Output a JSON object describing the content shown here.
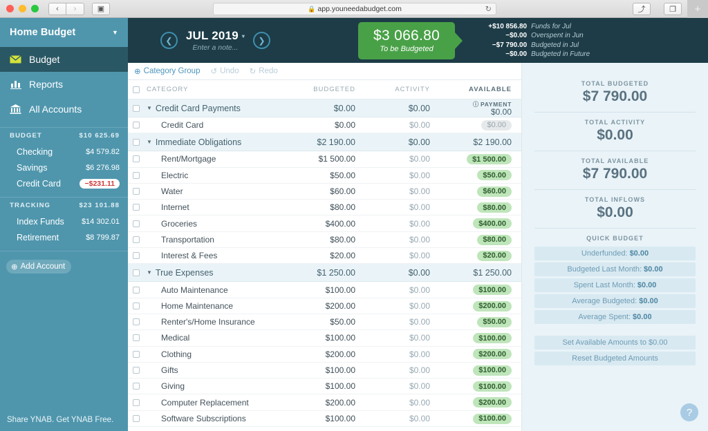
{
  "browser": {
    "back_label": "‹",
    "forward_label": "›",
    "sidebar_toggle_label": "▣",
    "url": "app.youneedabudget.com",
    "lock_icon": "🔒",
    "reload_label": "↻",
    "share_label": "⤴",
    "tabs_label": "❐",
    "new_tab_label": "+"
  },
  "sidebar": {
    "budget_name": "Home Budget",
    "caret": "▼",
    "nav": [
      {
        "label": "Budget",
        "icon": "envelope-icon",
        "active": true
      },
      {
        "label": "Reports",
        "icon": "bar-chart-icon",
        "active": false
      },
      {
        "label": "All Accounts",
        "icon": "bank-icon",
        "active": false
      }
    ],
    "sections": [
      {
        "title": "BUDGET",
        "total": "$10 625.69",
        "chevron": "ⱟ",
        "accounts": [
          {
            "name": "Checking",
            "balance": "$4 579.82",
            "negative": false
          },
          {
            "name": "Savings",
            "balance": "$6 276.98",
            "negative": false
          },
          {
            "name": "Credit Card",
            "balance": "−$231.11",
            "negative": true
          }
        ]
      },
      {
        "title": "TRACKING",
        "total": "$23 101.88",
        "chevron": "ⱟ",
        "accounts": [
          {
            "name": "Index Funds",
            "balance": "$14 302.01",
            "negative": false
          },
          {
            "name": "Retirement",
            "balance": "$8 799.87",
            "negative": false
          }
        ]
      }
    ],
    "add_account_label": "Add Account",
    "add_account_icon": "⊕",
    "share_label": "Share YNAB. Get YNAB Free."
  },
  "month_header": {
    "prev_icon": "❮",
    "next_icon": "❯",
    "month": "JUL 2019",
    "caret": "▾",
    "note_placeholder": "Enter a note...",
    "to_be_budgeted": {
      "amount": "$3 066.80",
      "label": "To be Budgeted",
      "color": "#49a147"
    },
    "breakdown": [
      {
        "value": "+$10 856.80",
        "label": "Funds for Jul"
      },
      {
        "value": "−$0.00",
        "label": "Overspent in Jun"
      },
      {
        "value": "−$7 790.00",
        "label": "Budgeted in Jul"
      },
      {
        "value": "−$0.00",
        "label": "Budgeted in Future"
      }
    ]
  },
  "toolbar": {
    "category_group_label": "Category Group",
    "category_group_icon": "⊕",
    "undo_label": "Undo",
    "undo_icon": "↺",
    "redo_label": "Redo",
    "redo_icon": "↻"
  },
  "table": {
    "columns": {
      "category": "CATEGORY",
      "budgeted": "BUDGETED",
      "activity": "ACTIVITY",
      "available": "AVAILABLE"
    },
    "twisty": "▼",
    "rows": [
      {
        "type": "group",
        "name": "Credit Card Payments",
        "budgeted": "$0.00",
        "activity": "$0.00",
        "available": "$0.00",
        "available_tag": "PAYMENT",
        "available_tag_icon": "ⓘ"
      },
      {
        "type": "category",
        "name": "Credit Card",
        "budgeted": "$0.00",
        "activity": "$0.00",
        "available": "$0.00",
        "available_style": "zero"
      },
      {
        "type": "group",
        "name": "Immediate Obligations",
        "budgeted": "$2 190.00",
        "activity": "$0.00",
        "available": "$2 190.00"
      },
      {
        "type": "category",
        "name": "Rent/Mortgage",
        "budgeted": "$1 500.00",
        "activity": "$0.00",
        "available": "$1 500.00",
        "available_style": "positive"
      },
      {
        "type": "category",
        "name": "Electric",
        "budgeted": "$50.00",
        "activity": "$0.00",
        "available": "$50.00",
        "available_style": "positive"
      },
      {
        "type": "category",
        "name": "Water",
        "budgeted": "$60.00",
        "activity": "$0.00",
        "available": "$60.00",
        "available_style": "positive"
      },
      {
        "type": "category",
        "name": "Internet",
        "budgeted": "$80.00",
        "activity": "$0.00",
        "available": "$80.00",
        "available_style": "positive"
      },
      {
        "type": "category",
        "name": "Groceries",
        "budgeted": "$400.00",
        "activity": "$0.00",
        "available": "$400.00",
        "available_style": "positive"
      },
      {
        "type": "category",
        "name": "Transportation",
        "budgeted": "$80.00",
        "activity": "$0.00",
        "available": "$80.00",
        "available_style": "positive"
      },
      {
        "type": "category",
        "name": "Interest & Fees",
        "budgeted": "$20.00",
        "activity": "$0.00",
        "available": "$20.00",
        "available_style": "positive"
      },
      {
        "type": "group",
        "name": "True Expenses",
        "budgeted": "$1 250.00",
        "activity": "$0.00",
        "available": "$1 250.00"
      },
      {
        "type": "category",
        "name": "Auto Maintenance",
        "budgeted": "$100.00",
        "activity": "$0.00",
        "available": "$100.00",
        "available_style": "positive"
      },
      {
        "type": "category",
        "name": "Home Maintenance",
        "budgeted": "$200.00",
        "activity": "$0.00",
        "available": "$200.00",
        "available_style": "positive"
      },
      {
        "type": "category",
        "name": "Renter's/Home Insurance",
        "budgeted": "$50.00",
        "activity": "$0.00",
        "available": "$50.00",
        "available_style": "positive"
      },
      {
        "type": "category",
        "name": "Medical",
        "budgeted": "$100.00",
        "activity": "$0.00",
        "available": "$100.00",
        "available_style": "positive"
      },
      {
        "type": "category",
        "name": "Clothing",
        "budgeted": "$200.00",
        "activity": "$0.00",
        "available": "$200.00",
        "available_style": "positive"
      },
      {
        "type": "category",
        "name": "Gifts",
        "budgeted": "$100.00",
        "activity": "$0.00",
        "available": "$100.00",
        "available_style": "positive"
      },
      {
        "type": "category",
        "name": "Giving",
        "budgeted": "$100.00",
        "activity": "$0.00",
        "available": "$100.00",
        "available_style": "positive"
      },
      {
        "type": "category",
        "name": "Computer Replacement",
        "budgeted": "$200.00",
        "activity": "$0.00",
        "available": "$200.00",
        "available_style": "positive"
      },
      {
        "type": "category",
        "name": "Software Subscriptions",
        "budgeted": "$100.00",
        "activity": "$0.00",
        "available": "$100.00",
        "available_style": "positive"
      }
    ]
  },
  "inspector": {
    "totals": [
      {
        "label": "TOTAL BUDGETED",
        "value": "$7 790.00"
      },
      {
        "label": "TOTAL ACTIVITY",
        "value": "$0.00"
      },
      {
        "label": "TOTAL AVAILABLE",
        "value": "$7 790.00"
      },
      {
        "label": "TOTAL INFLOWS",
        "value": "$0.00"
      }
    ],
    "quick_budget_title": "QUICK BUDGET",
    "quick_budget_buttons": [
      {
        "label": "Underfunded:",
        "value": "$0.00"
      },
      {
        "label": "Budgeted Last Month:",
        "value": "$0.00"
      },
      {
        "label": "Spent Last Month:",
        "value": "$0.00"
      },
      {
        "label": "Average Budgeted:",
        "value": "$0.00"
      },
      {
        "label": "Average Spent:",
        "value": "$0.00"
      }
    ],
    "actions": [
      {
        "label": "Set Available Amounts to $0.00"
      },
      {
        "label": "Reset Budgeted Amounts"
      }
    ],
    "help_icon": "?"
  }
}
